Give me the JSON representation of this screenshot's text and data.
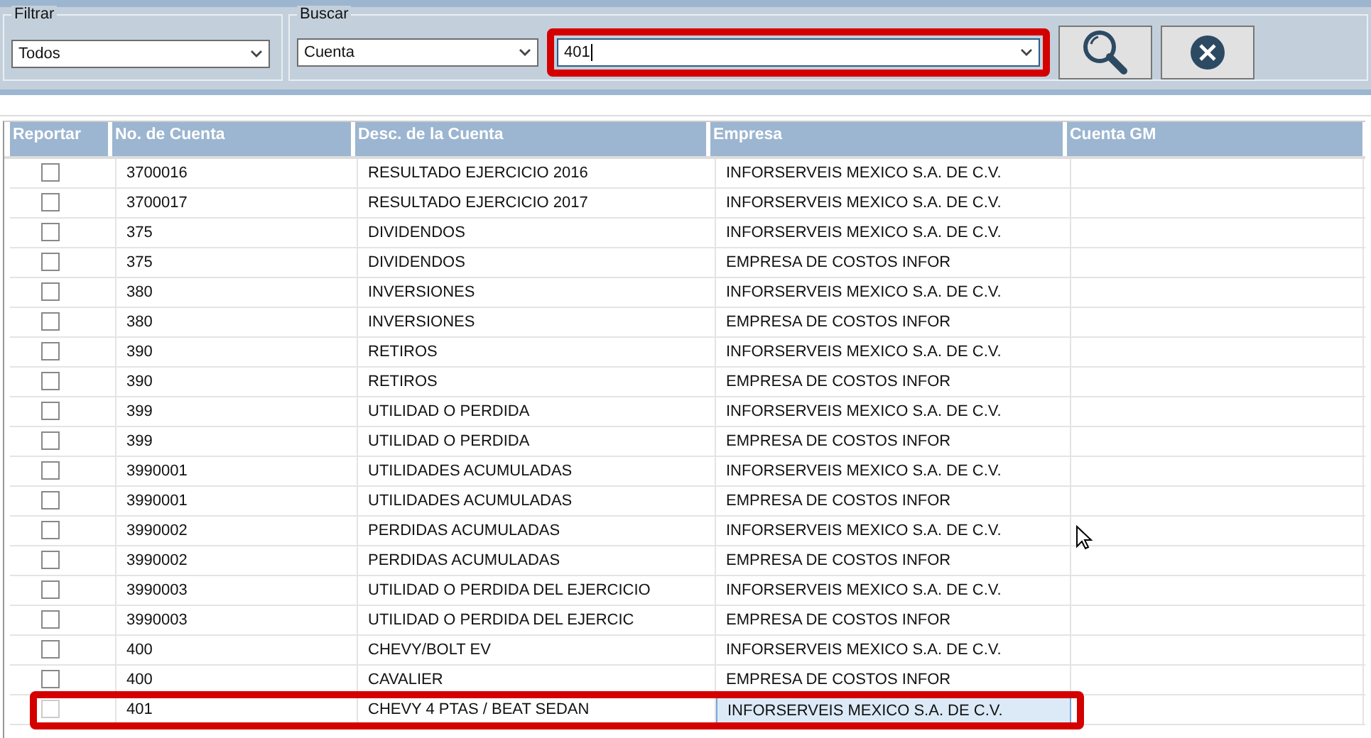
{
  "filter": {
    "legend": "Filtrar",
    "value": "Todos"
  },
  "search": {
    "legend": "Buscar",
    "field_value": "Cuenta",
    "query": "401",
    "annotated": true
  },
  "table": {
    "columns": [
      "Reportar",
      "No. de Cuenta",
      "Desc. de la Cuenta",
      "Empresa",
      "Cuenta GM"
    ],
    "rows": [
      {
        "checked": false,
        "account": "3700016",
        "description": "RESULTADO EJERCICIO 2016",
        "company": "INFORSERVEIS MEXICO S.A. DE C.V.",
        "selected": false,
        "annotated": false
      },
      {
        "checked": false,
        "account": "3700017",
        "description": "RESULTADO EJERCICIO 2017",
        "company": "INFORSERVEIS MEXICO S.A. DE C.V.",
        "selected": false,
        "annotated": false
      },
      {
        "checked": false,
        "account": "375",
        "description": "DIVIDENDOS",
        "company": "INFORSERVEIS MEXICO S.A. DE C.V.",
        "selected": false,
        "annotated": false
      },
      {
        "checked": false,
        "account": "375",
        "description": "DIVIDENDOS",
        "company": "EMPRESA DE COSTOS INFOR",
        "selected": false,
        "annotated": false
      },
      {
        "checked": false,
        "account": "380",
        "description": "INVERSIONES",
        "company": "INFORSERVEIS MEXICO S.A. DE C.V.",
        "selected": false,
        "annotated": false
      },
      {
        "checked": false,
        "account": "380",
        "description": "INVERSIONES",
        "company": "EMPRESA DE COSTOS INFOR",
        "selected": false,
        "annotated": false
      },
      {
        "checked": false,
        "account": "390",
        "description": "RETIROS",
        "company": "INFORSERVEIS MEXICO S.A. DE C.V.",
        "selected": false,
        "annotated": false
      },
      {
        "checked": false,
        "account": "390",
        "description": "RETIROS",
        "company": "EMPRESA DE COSTOS INFOR",
        "selected": false,
        "annotated": false
      },
      {
        "checked": false,
        "account": "399",
        "description": "UTILIDAD O PERDIDA",
        "company": "INFORSERVEIS MEXICO S.A. DE C.V.",
        "selected": false,
        "annotated": false
      },
      {
        "checked": false,
        "account": "399",
        "description": "UTILIDAD O PERDIDA",
        "company": "EMPRESA DE COSTOS INFOR",
        "selected": false,
        "annotated": false
      },
      {
        "checked": false,
        "account": "3990001",
        "description": "UTILIDADES ACUMULADAS",
        "company": "INFORSERVEIS MEXICO S.A. DE C.V.",
        "selected": false,
        "annotated": false
      },
      {
        "checked": false,
        "account": "3990001",
        "description": "UTILIDADES ACUMULADAS",
        "company": "EMPRESA DE COSTOS INFOR",
        "selected": false,
        "annotated": false
      },
      {
        "checked": false,
        "account": "3990002",
        "description": "PERDIDAS ACUMULADAS",
        "company": "INFORSERVEIS MEXICO S.A. DE C.V.",
        "selected": false,
        "annotated": false
      },
      {
        "checked": false,
        "account": "3990002",
        "description": "PERDIDAS ACUMULADAS",
        "company": "EMPRESA DE COSTOS INFOR",
        "selected": false,
        "annotated": false
      },
      {
        "checked": false,
        "account": "3990003",
        "description": "UTILIDAD O PERDIDA DEL EJERCICIO",
        "company": "INFORSERVEIS MEXICO S.A. DE C.V.",
        "selected": false,
        "annotated": false
      },
      {
        "checked": false,
        "account": "3990003",
        "description": "UTILIDAD O PERDIDA DEL EJERCIC",
        "company": "EMPRESA DE COSTOS INFOR",
        "selected": false,
        "annotated": false
      },
      {
        "checked": false,
        "account": "400",
        "description": "CHEVY/BOLT EV",
        "company": "INFORSERVEIS MEXICO S.A. DE C.V.",
        "selected": false,
        "annotated": false
      },
      {
        "checked": false,
        "account": "400",
        "description": "CAVALIER",
        "company": "EMPRESA DE COSTOS INFOR",
        "selected": false,
        "annotated": false
      },
      {
        "checked": false,
        "account": "401",
        "description": "CHEVY 4 PTAS / BEAT SEDAN",
        "company": "INFORSERVEIS MEXICO S.A. DE C.V.",
        "selected": true,
        "annotated": true
      }
    ]
  }
}
